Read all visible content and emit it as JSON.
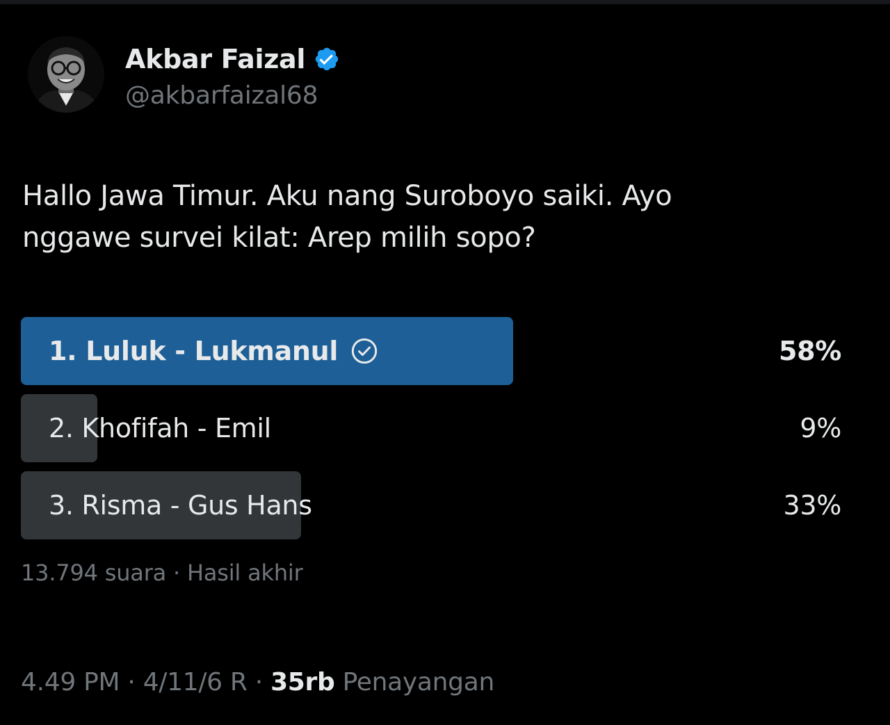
{
  "author": {
    "display_name": "Akbar Faizal",
    "handle": "@akbarfaizal68",
    "verified": true,
    "verified_color": "#1d9bf0"
  },
  "tweet": {
    "text": "Hallo Jawa Timur. Aku nang Suroboyo saiki. Ayo\nnggawe survei kilat: Arep milih sopo?"
  },
  "poll": {
    "winner_color": "#1d5f96",
    "other_color": "#333639",
    "options": [
      {
        "label": "1. Luluk - Lukmanul",
        "percent_text": "58%",
        "percent": 58,
        "winner": true
      },
      {
        "label": "2. Khofifah - Emil",
        "percent_text": "9%",
        "percent": 9,
        "winner": false
      },
      {
        "label": "3. Risma - Gus Hans",
        "percent_text": "33%",
        "percent": 33,
        "winner": false
      }
    ],
    "meta": "13.794 suara · Hasil akhir"
  },
  "footer": {
    "time": "4.49 PM · 4/11/6 R · ",
    "views_count": "35rb",
    "views_label": " Penayangan"
  }
}
